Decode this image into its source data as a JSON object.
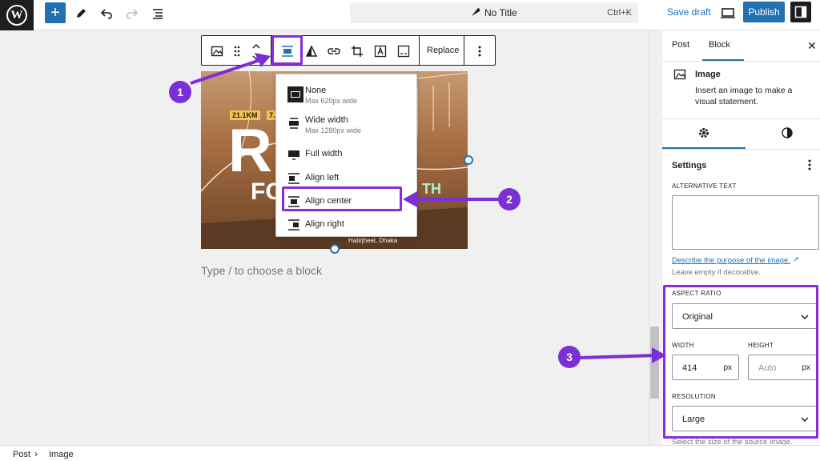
{
  "topbar": {
    "document_title": "No Title",
    "shortcut": "Ctrl+K",
    "save_draft": "Save draft",
    "publish": "Publish",
    "wp_logo": "W"
  },
  "block_toolbar": {
    "replace": "Replace"
  },
  "image": {
    "overlay_texts": [
      "21.1KM",
      "7.5",
      "R",
      "FO",
      "TH",
      "Hatirjheel, Dhaka"
    ]
  },
  "align_menu": {
    "items": [
      {
        "label": "None",
        "sublabel": "Max 620px wide",
        "icon": "align-none-icon"
      },
      {
        "label": "Wide width",
        "sublabel": "Max 1280px wide",
        "icon": "align-wide-icon"
      },
      {
        "label": "Full width",
        "sublabel": "",
        "icon": "align-full-icon"
      },
      {
        "label": "Align left",
        "sublabel": "",
        "icon": "align-left-icon"
      },
      {
        "label": "Align center",
        "sublabel": "",
        "icon": "align-center-icon"
      },
      {
        "label": "Align right",
        "sublabel": "",
        "icon": "align-right-icon"
      }
    ]
  },
  "canvas": {
    "placeholder": "Type / to choose a block"
  },
  "sidebar": {
    "tabs": [
      "Post",
      "Block"
    ],
    "active_tab": "Block",
    "block_title": "Image",
    "block_description": "Insert an image to make a visual statement.",
    "panel_title": "Settings",
    "alt_text_label": "ALTERNATIVE TEXT",
    "alt_text_value": "",
    "alt_link": "Describe the purpose of the image.",
    "alt_help": "Leave empty if decorative.",
    "aspect_ratio_label": "ASPECT RATIO",
    "aspect_ratio_value": "Original",
    "width_label": "WIDTH",
    "width_value": "414",
    "width_unit": "px",
    "height_label": "HEIGHT",
    "height_placeholder": "Auto",
    "height_unit": "px",
    "resolution_label": "RESOLUTION",
    "resolution_value": "Large",
    "resolution_help": "Select the size of the source image."
  },
  "statusbar": {
    "crumbs": [
      "Post",
      "Image"
    ]
  },
  "annotations": [
    "1",
    "2",
    "3"
  ],
  "colors": {
    "accent": "#2271b1",
    "annotation": "#7b2fd6",
    "dark": "#1e1e1e"
  }
}
